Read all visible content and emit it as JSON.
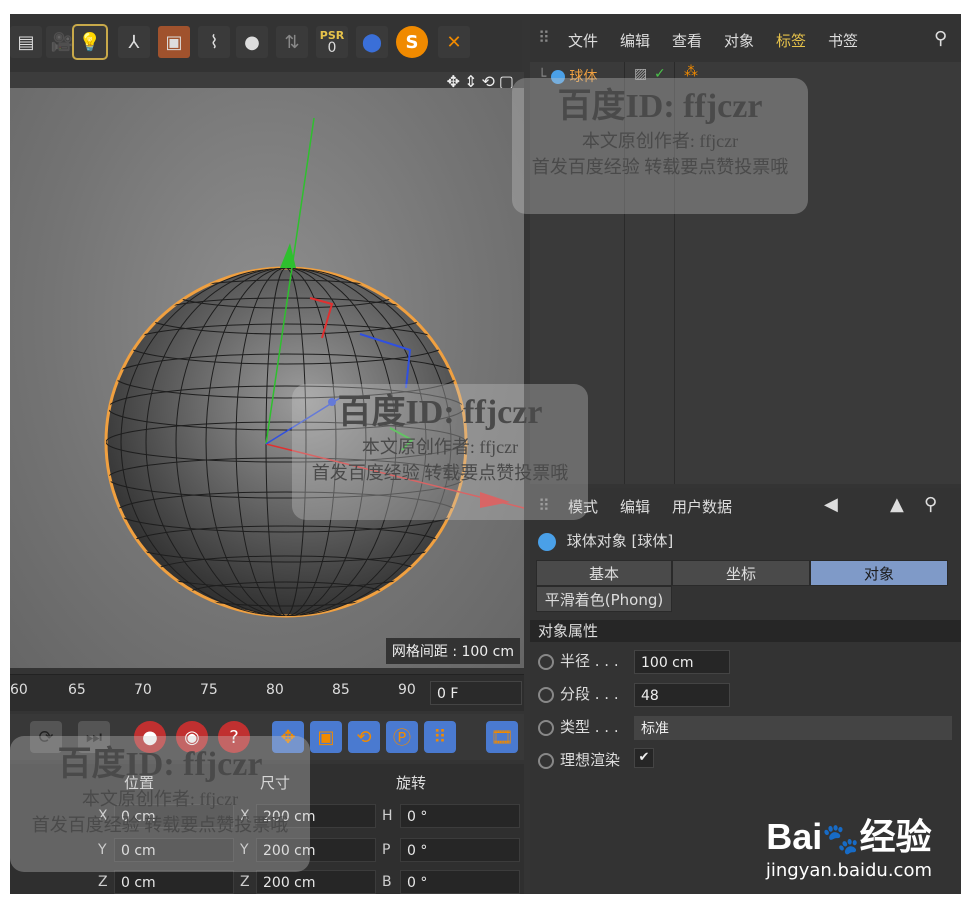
{
  "toolbar": {
    "psr_label": "PSR",
    "psr_value": "0"
  },
  "viewport": {
    "grid_label": "网格间距 : 100 cm"
  },
  "timeline": {
    "ticks": [
      "60",
      "65",
      "70",
      "75",
      "80",
      "85",
      "90"
    ],
    "frame_value": "0 F"
  },
  "coords": {
    "headers": [
      "位置",
      "尺寸",
      "旋转"
    ],
    "rows": [
      {
        "axis": "X",
        "pos": "0 cm",
        "size_axis": "X",
        "size": "200 cm",
        "rot_axis": "H",
        "rot": "0 °"
      },
      {
        "axis": "Y",
        "pos": "0 cm",
        "size_axis": "Y",
        "size": "200 cm",
        "rot_axis": "P",
        "rot": "0 °"
      },
      {
        "axis": "Z",
        "pos": "0 cm",
        "size_axis": "Z",
        "size": "200 cm",
        "rot_axis": "B",
        "rot": "0 °"
      }
    ]
  },
  "object_manager": {
    "menu": [
      "文件",
      "编辑",
      "查看",
      "对象",
      "标签",
      "书签"
    ],
    "active_menu": "标签",
    "object_name": "球体"
  },
  "attribute_manager": {
    "menu": [
      "模式",
      "编辑",
      "用户数据"
    ],
    "title": "球体对象 [球体]",
    "tabs": [
      "基本",
      "坐标",
      "对象"
    ],
    "active_tab": "对象",
    "subtab": "平滑着色(Phong)",
    "section": "对象属性",
    "props": [
      {
        "label": "半径 . . .",
        "value": "100 cm"
      },
      {
        "label": "分段 . . .",
        "value": "48"
      },
      {
        "label": "类型 . . .",
        "value": "标准"
      },
      {
        "label": "理想渲染",
        "value": "✔"
      }
    ]
  },
  "watermark": {
    "title": "百度ID: ffjczr",
    "line1": "本文原创作者: ffjczr",
    "line2": "首发百度经验 转载要点赞投票哦"
  },
  "brand": {
    "logo_text": "Bai",
    "logo_text2": "经验",
    "url": "jingyan.baidu.com"
  },
  "colors": {
    "accent_tab": "#7f9ac8",
    "active_menu": "#e6c24a",
    "selection_orange": "#f0a040"
  }
}
